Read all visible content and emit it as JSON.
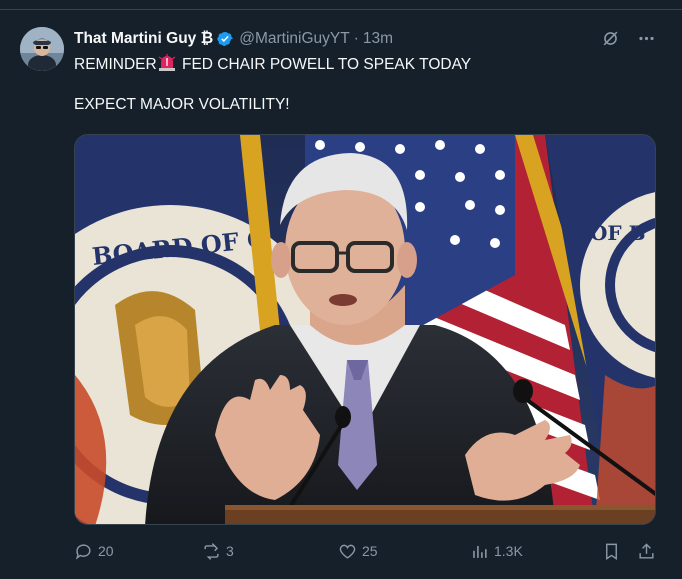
{
  "tweet": {
    "author_name": "That Martini Guy ₿",
    "handle": "@MartiniGuyYT",
    "separator": "·",
    "time": "13m",
    "text_line1_a": "REMINDER",
    "text_line1_b": " FED CHAIR POWELL TO SPEAK TODAY",
    "text_line2": "EXPECT MAJOR VOLATILITY!",
    "media_seal_text": "BOARD OF G",
    "media_seal_text_right": "OF B",
    "actions": {
      "replies": "20",
      "retweets": "3",
      "likes": "25",
      "views": "1.3K"
    }
  },
  "icons": {
    "verified": "verified-badge-icon",
    "grok": "grok-icon",
    "more": "more-icon",
    "siren": "siren-emoji-icon",
    "reply": "reply-icon",
    "retweet": "retweet-icon",
    "like": "heart-icon",
    "views": "views-icon",
    "bookmark": "bookmark-icon",
    "share": "share-icon"
  },
  "colors": {
    "background": "#15202b",
    "text": "#f7f9f9",
    "secondary": "#8b98a5",
    "verified": "#1d9bf0",
    "border": "#38444d"
  }
}
